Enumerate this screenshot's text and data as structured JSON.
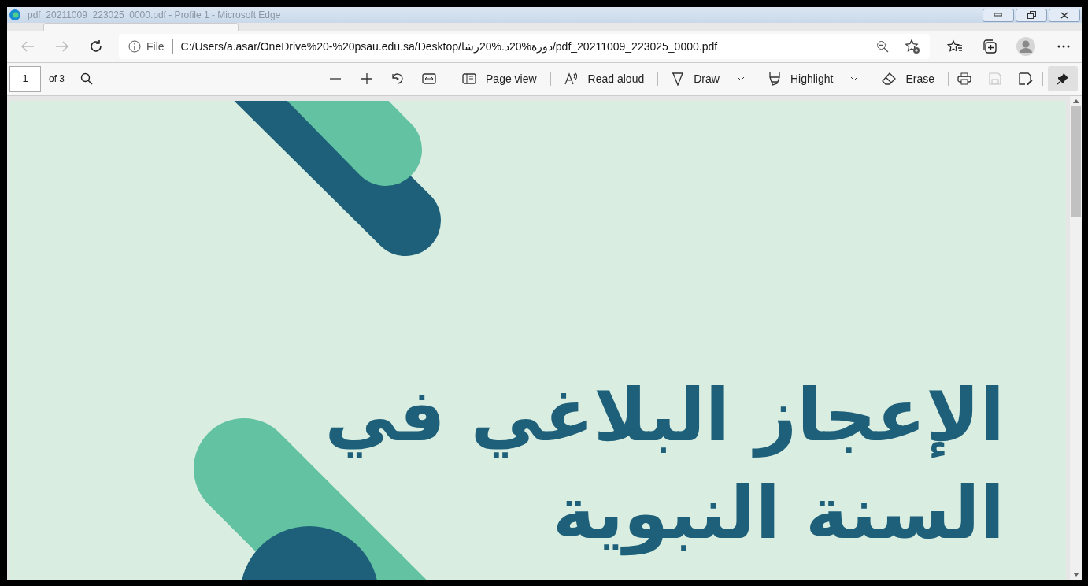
{
  "window": {
    "title": "pdf_20211009_223025_0000.pdf - Profile 1 - Microsoft Edge"
  },
  "address_bar": {
    "site_info": "File",
    "url": "C:/Users/a.asar/OneDrive%20-%20psau.edu.sa/Desktop/دورة%20د.%20رشا/pdf_20211009_223025_0000.pdf"
  },
  "pdf_toolbar": {
    "page_number": "1",
    "page_count": "of 3",
    "tools": [
      {
        "kind": "pageview",
        "label": "Page view",
        "dropdown": false
      },
      {
        "kind": "readaloud",
        "label": "Read aloud",
        "dropdown": false
      },
      {
        "kind": "draw",
        "label": "Draw",
        "dropdown": true
      },
      {
        "kind": "highlight",
        "label": "Highlight",
        "dropdown": true
      },
      {
        "kind": "erase",
        "label": "Erase",
        "dropdown": false
      }
    ],
    "save_disabled": true,
    "pinned": true
  },
  "document": {
    "title_lines": [
      "الإعجاز البلاغي في",
      "السنة النبوية"
    ]
  }
}
